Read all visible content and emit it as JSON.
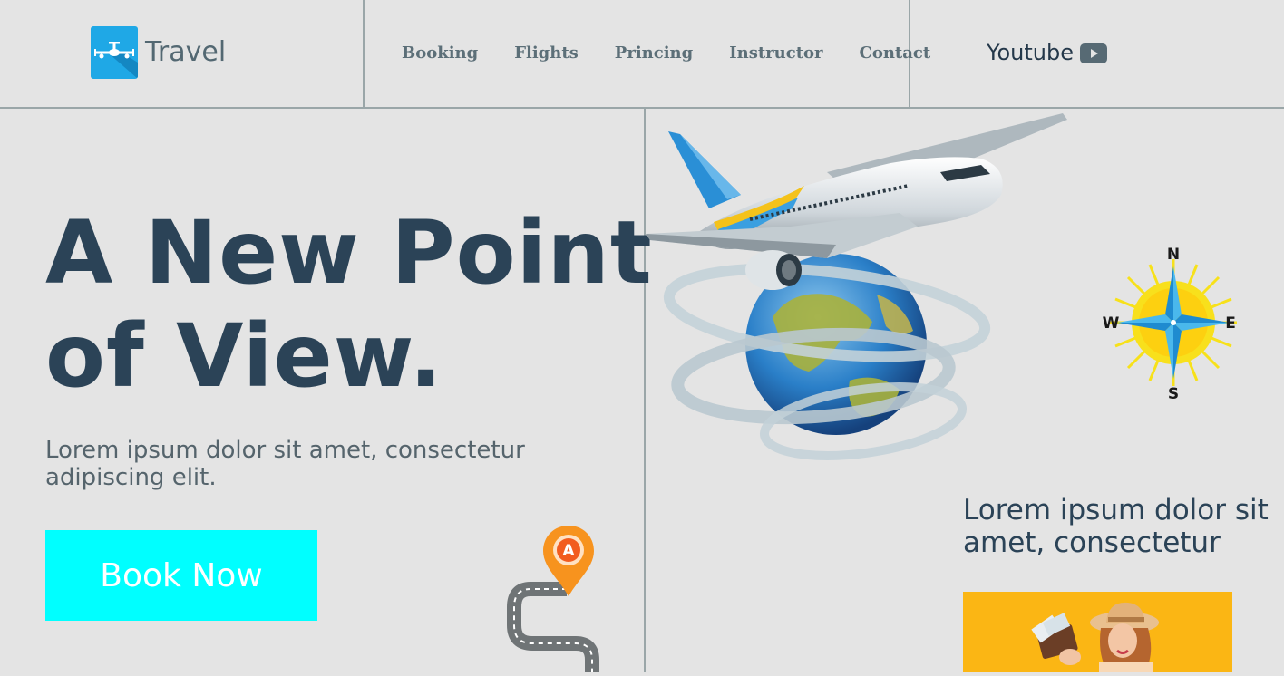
{
  "header": {
    "logo_text": "Travel",
    "nav": [
      "Booking",
      "Flights",
      "Princing",
      "Instructor",
      "Contact"
    ],
    "youtube_label": "Youtube"
  },
  "hero": {
    "title_line1": "A New Point",
    "title_line2": "of View.",
    "subtitle_line1": "Lorem ipsum dolor sit amet, consectetur",
    "subtitle_line2": "adipiscing elit.",
    "cta_label": "Book Now"
  },
  "illustrations": {
    "compass": {
      "north": "N",
      "south": "S",
      "east": "E",
      "west": "W"
    },
    "map_pin": "A"
  },
  "side": {
    "title_line1": "Lorem ipsum dolor sit",
    "title_line2": "amet, consectetur"
  },
  "colors": {
    "background": "#e4e4e4",
    "heading": "#2b4357",
    "cta": "#00ffff",
    "logo": "#1fa8e6",
    "card": "#fbb614"
  }
}
